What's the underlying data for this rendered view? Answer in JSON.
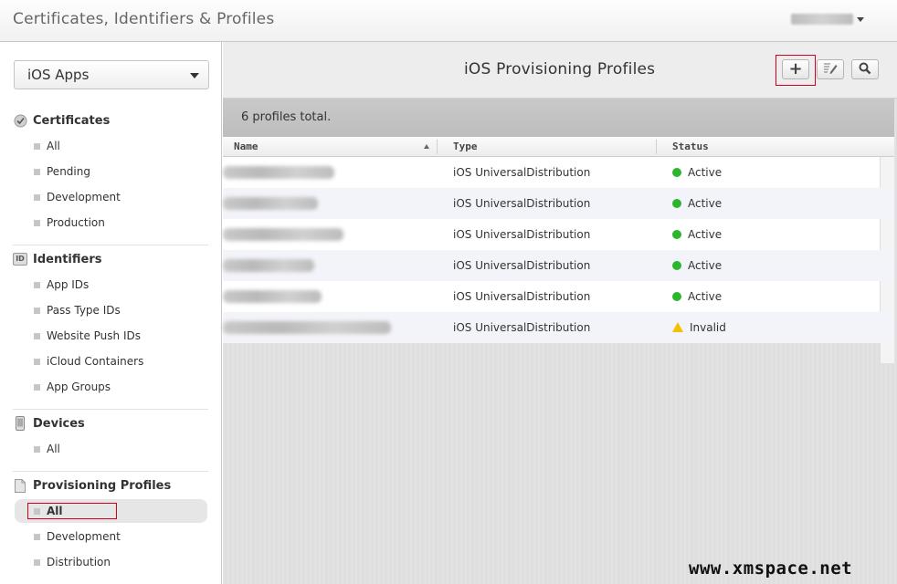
{
  "header": {
    "title": "Certificates, Identifiers & Profiles"
  },
  "sidebar": {
    "platform_select": "iOS Apps",
    "sections": {
      "certificates": {
        "title": "Certificates",
        "items": [
          "All",
          "Pending",
          "Development",
          "Production"
        ]
      },
      "identifiers": {
        "title": "Identifiers",
        "icon_text": "ID",
        "items": [
          "App IDs",
          "Pass Type IDs",
          "Website Push IDs",
          "iCloud Containers",
          "App Groups"
        ]
      },
      "devices": {
        "title": "Devices",
        "items": [
          "All"
        ]
      },
      "profiles": {
        "title": "Provisioning Profiles",
        "items": [
          "All",
          "Development",
          "Distribution"
        ],
        "active": "All"
      }
    }
  },
  "main": {
    "title": "iOS Provisioning Profiles",
    "toolbar": {
      "add": "+",
      "edit": "edit-icon",
      "search": "search-icon"
    },
    "summary": "6 profiles total.",
    "columns": [
      "Name",
      "Type",
      "Status"
    ],
    "rows": [
      {
        "type": "iOS UniversalDistribution",
        "status": "Active"
      },
      {
        "type": "iOS UniversalDistribution",
        "status": "Active"
      },
      {
        "type": "iOS UniversalDistribution",
        "status": "Active"
      },
      {
        "type": "iOS UniversalDistribution",
        "status": "Active"
      },
      {
        "type": "iOS UniversalDistribution",
        "status": "Active"
      },
      {
        "type": "iOS UniversalDistribution",
        "status": "Invalid"
      }
    ]
  },
  "watermark": "www.xmspace.net",
  "colors": {
    "active": "#2db52d",
    "invalid": "#f2c200",
    "highlight": "#d0021b"
  }
}
